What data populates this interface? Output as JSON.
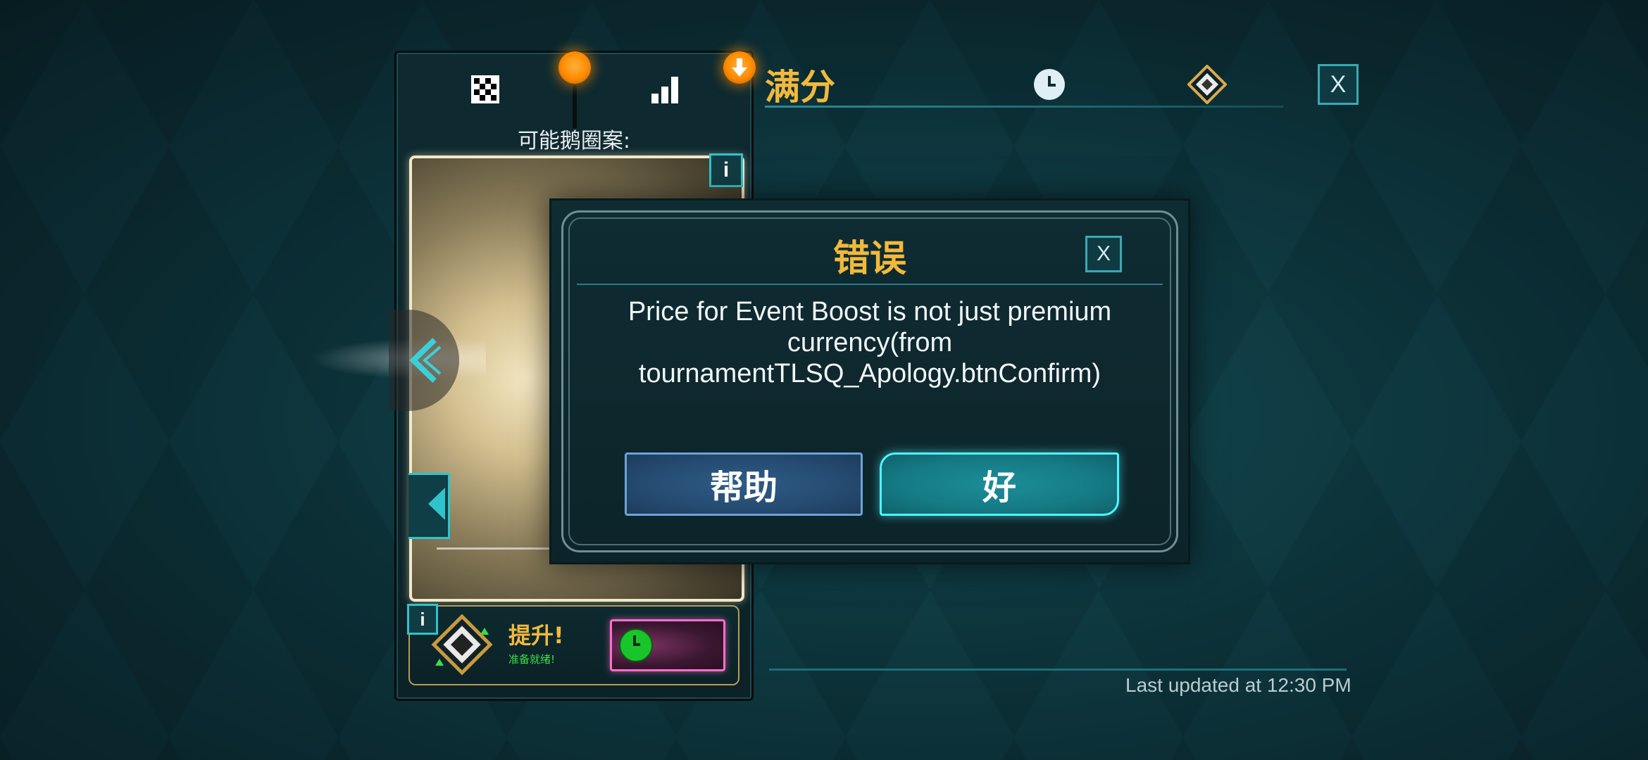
{
  "header": {
    "title": "满分"
  },
  "left_panel": {
    "patterns_label": "可能鹅圈案:",
    "info_glyph": "i"
  },
  "boost": {
    "info_glyph": "i",
    "title": "提升!",
    "subtitle": "准备就绪!"
  },
  "close_glyph": "X",
  "footer": {
    "last_updated": "Last updated at 12:30 PM"
  },
  "dialog": {
    "title": "错误",
    "close_glyph": "X",
    "message": "Price for Event Boost is not just premium currency(from tournamentTLSQ_Apology.btnConfirm)",
    "help_label": "帮助",
    "ok_label": "好"
  },
  "colors": {
    "accent_gold": "#f1b93c",
    "accent_cyan": "#4ef5ff",
    "sort_orange": "#ff8a00",
    "boost_pink": "#ff6ecb"
  },
  "icons": [
    "checkerboard-icon",
    "sort-orb-icon",
    "bar-chart-icon",
    "download-arrow-icon",
    "clock-icon",
    "diamond-emblem-icon",
    "close-icon",
    "chevron-left-icon",
    "info-icon"
  ]
}
